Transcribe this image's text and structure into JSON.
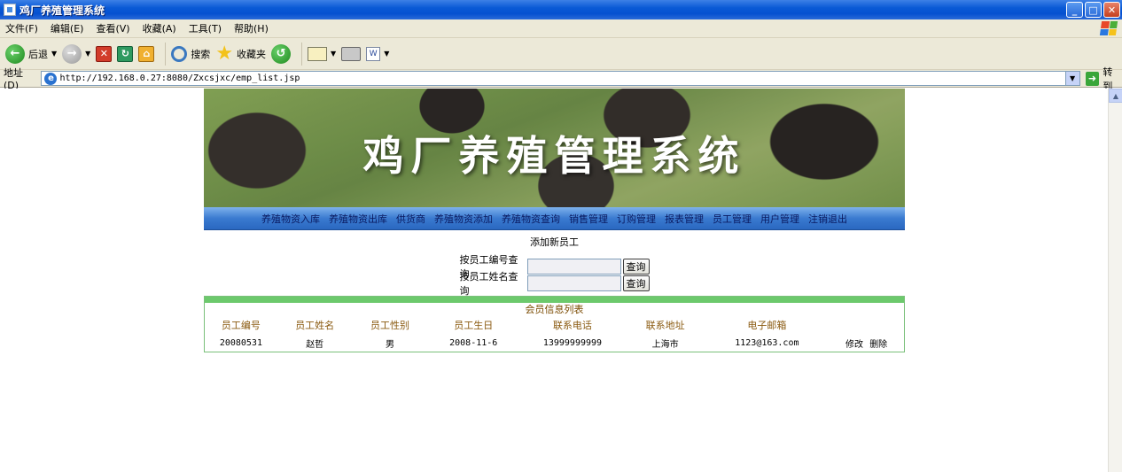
{
  "window": {
    "title": "鸡厂养殖管理系统",
    "buttons": {
      "minimize": "_",
      "maximize": "□",
      "close": "✕"
    }
  },
  "menubar": {
    "items": [
      "文件(F)",
      "编辑(E)",
      "查看(V)",
      "收藏(A)",
      "工具(T)",
      "帮助(H)"
    ]
  },
  "toolbar": {
    "back_label": "后退",
    "search_label": "搜索",
    "favorites_label": "收藏夹"
  },
  "addressbar": {
    "label": "地址(D)",
    "url": "http://192.168.0.27:8080/Zxcsjxc/emp_list.jsp",
    "go_label": "转到"
  },
  "banner": {
    "title": "鸡厂养殖管理系统"
  },
  "nav": {
    "items": [
      "养殖物资入库",
      "养殖物资出库",
      "供货商",
      "养殖物资添加",
      "养殖物资查询",
      "销售管理",
      "订购管理",
      "报表管理",
      "员工管理",
      "用户管理",
      "注销退出"
    ]
  },
  "page": {
    "add_link": "添加新员工"
  },
  "search": {
    "by_id_label": "按员工编号查询",
    "by_name_label": "按员工姓名查询",
    "button_label": "查询",
    "by_id_value": "",
    "by_name_value": ""
  },
  "list": {
    "title": "会员信息列表",
    "headers": [
      "员工编号",
      "员工姓名",
      "员工性别",
      "员工生日",
      "联系电话",
      "联系地址",
      "电子邮箱",
      ""
    ],
    "rows": [
      {
        "id": "20080531",
        "name": "赵哲",
        "gender": "男",
        "birthday": "2008-11-6",
        "phone": "13999999999",
        "address": "上海市",
        "email": "1123@163.com",
        "edit": "修改",
        "delete": "删除"
      }
    ]
  }
}
